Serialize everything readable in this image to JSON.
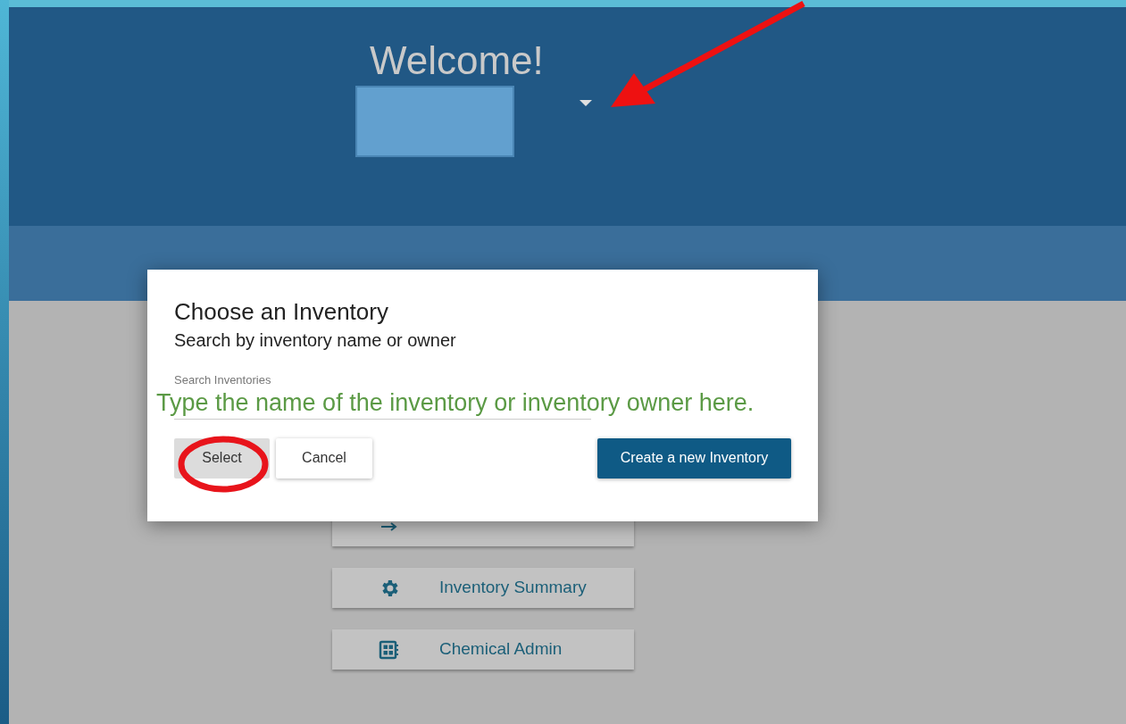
{
  "header": {
    "title": "Welcome!"
  },
  "menu": [
    {
      "label": "Inventory Summary"
    },
    {
      "label": "Chemical Admin"
    }
  ],
  "dialog": {
    "title": "Choose an Inventory",
    "subtitle": "Search by inventory name or owner",
    "search": {
      "label": "Search Inventories"
    },
    "buttons": [
      {
        "label": "Select",
        "kind": "flat"
      },
      {
        "label": "Cancel",
        "kind": "outlined"
      },
      {
        "label": "Create a new Inventory",
        "kind": "primary"
      }
    ]
  },
  "annotation_note": "Type the name of the inventory or inventory owner here."
}
